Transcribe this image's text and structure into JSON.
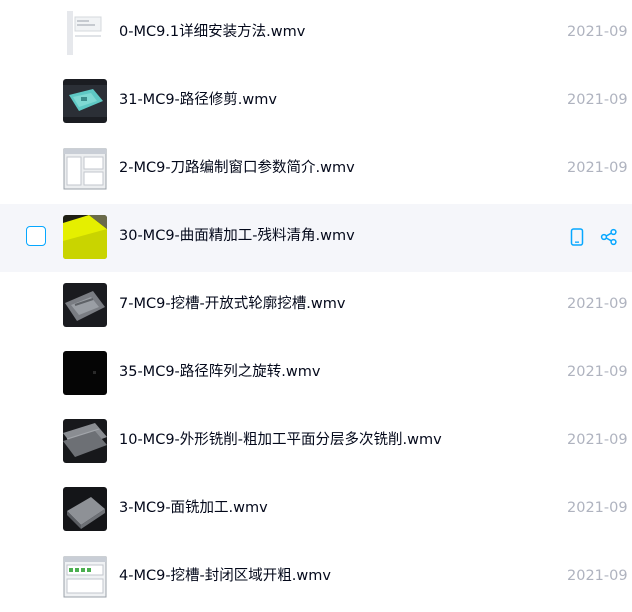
{
  "files": [
    {
      "name": "0-MC9.1详细安装方法.wmv",
      "date": "2021-09",
      "thumb": "doc-thumb"
    },
    {
      "name": "31-MC9-路径修剪.wmv",
      "date": "2021-09",
      "thumb": "cyan-model-thumb"
    },
    {
      "name": "2-MC9-刀路编制窗口参数简介.wmv",
      "date": "2021-09",
      "thumb": "window-thumb"
    },
    {
      "name": "30-MC9-曲面精加工-残料清角.wmv",
      "date": "",
      "thumb": "yellow-surface-thumb",
      "selected_row": true
    },
    {
      "name": "7-MC9-挖槽-开放式轮廓挖槽.wmv",
      "date": "2021-09",
      "thumb": "gray-model-thumb"
    },
    {
      "name": "35-MC9-路径阵列之旋转.wmv",
      "date": "2021-09",
      "thumb": "black-thumb"
    },
    {
      "name": "10-MC9-外形铣削-粗加工平面分层多次铣削.wmv",
      "date": "2021-09",
      "thumb": "gray-plate-thumb"
    },
    {
      "name": "3-MC9-面铣加工.wmv",
      "date": "2021-09",
      "thumb": "dark-plate-thumb"
    },
    {
      "name": "4-MC9-挖槽-封闭区域开粗.wmv",
      "date": "2021-09",
      "thumb": "dialog-thumb"
    }
  ],
  "hover_actions": {
    "phone_icon": "phone-icon",
    "share_icon": "share-icon"
  },
  "colors": {
    "accent": "#06a7ff",
    "text": "#03081a",
    "muted": "#afb3bf",
    "hover_bg": "#f5f6fa"
  }
}
